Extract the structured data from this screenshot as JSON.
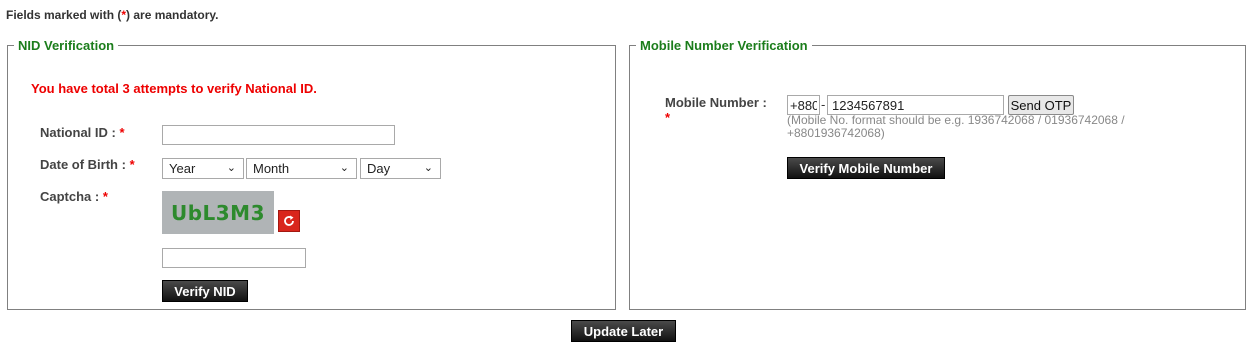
{
  "note": {
    "pre": "Fields marked with (",
    "star": "*",
    "post": ") are mandatory."
  },
  "nid": {
    "legend": "NID Verification",
    "attempts": "You have total 3 attempts to verify National ID.",
    "national_id_label": "National ID : ",
    "national_id_value": "",
    "dob_label": "Date of Birth : ",
    "year": "Year",
    "month": "Month",
    "day": "Day",
    "captcha_label": "Captcha : ",
    "captcha_text": "UbL3M3",
    "captcha_input_value": "",
    "verify_label": "Verify NID",
    "required_mark": "*"
  },
  "mobile": {
    "legend": "Mobile Number Verification",
    "label": "Mobile Number : ",
    "required_mark": "*",
    "prefix": "+880",
    "dash": "-",
    "number": "1234567891",
    "send_otp": "Send OTP",
    "hint": "(Mobile No. format should be e.g. 1936742068 / 01936742068 / +8801936742068)",
    "verify_label": "Verify Mobile Number"
  },
  "update_later": "Update Later",
  "icons": {
    "refresh": "refresh-icon",
    "select_arrow": "chevron-down-icon"
  },
  "colors": {
    "legend": "#1b7d1b",
    "required": "#e00000",
    "button": "#1a1a1a",
    "refresh": "#d9261c"
  }
}
